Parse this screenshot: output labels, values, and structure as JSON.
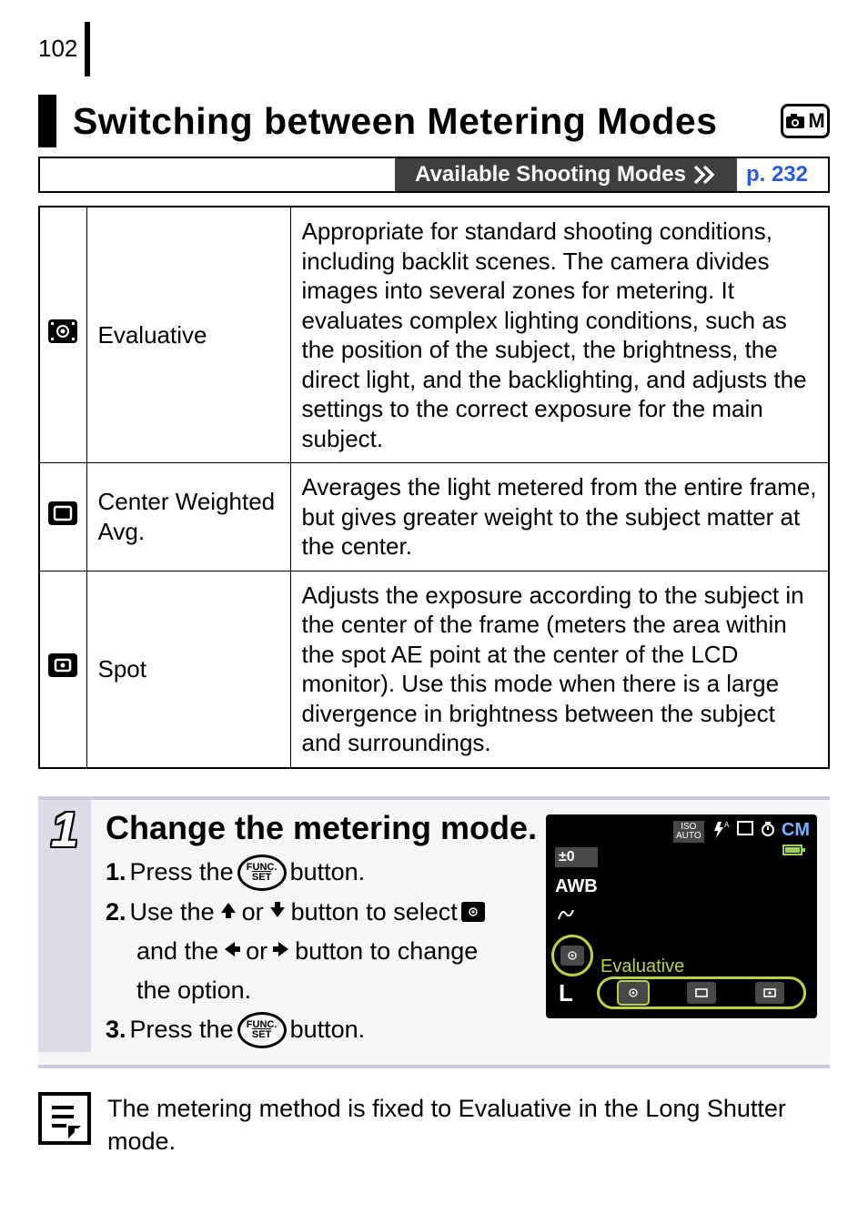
{
  "page_number": "102",
  "section_title": "Switching between Metering Modes",
  "mode_badge_label": "M",
  "available_modes_label": "Available Shooting Modes",
  "available_modes_link": "p. 232",
  "modes": [
    {
      "icon": "evaluative",
      "name": "Evaluative",
      "desc": "Appropriate for standard shooting conditions, including backlit scenes. The camera divides images into several zones for metering. It evaluates complex lighting conditions, such as the position of the subject, the brightness, the direct light, and the backlighting, and adjusts the settings to the correct exposure for the main subject."
    },
    {
      "icon": "center-weighted",
      "name": "Center Weighted Avg.",
      "desc": "Averages the light metered from the entire frame, but gives greater weight to the subject matter at the center."
    },
    {
      "icon": "spot",
      "name": "Spot",
      "desc": "Adjusts the exposure according to the subject in the center of the frame (meters the area within the spot AE point at the center of the LCD monitor). Use this mode when there is a large divergence in brightness between the subject and surroundings."
    }
  ],
  "step": {
    "number": "1",
    "title": "Change the metering mode.",
    "line1_num": "1.",
    "line1_a": "Press the ",
    "line1_b": " button.",
    "line2_num": "2.",
    "line2_a": "Use the ",
    "line2_b": " or ",
    "line2_c": " button to select ",
    "line2_d": "and the ",
    "line2_e": " or ",
    "line2_f": " button to change",
    "line2_g": "the option.",
    "line3_num": "3.",
    "line3_a": "Press the ",
    "line3_b": " button.",
    "func_top": "FUNC.",
    "func_bot": "SET"
  },
  "lcd": {
    "pm0": "±0",
    "awb": "AWB",
    "eval": "Evaluative",
    "L": "L",
    "iso": "ISO",
    "auto": "AUTO"
  },
  "note_text": "The metering method is fixed to Evaluative in the Long Shutter mode."
}
